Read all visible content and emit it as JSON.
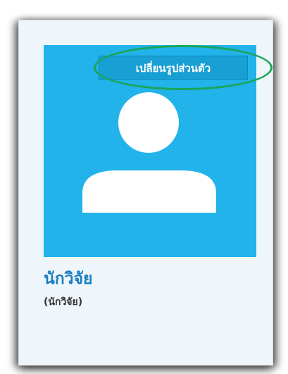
{
  "profile": {
    "change_photo_label": "เปลี่ยนรูปส่วนตัว",
    "display_name": "นักวิจัย",
    "role": "(นักวิจัย)",
    "avatar_icon": "user-silhouette-icon"
  },
  "colors": {
    "card_background": "#eef6fb",
    "photo_background": "#21b3ea",
    "button_background": "#189fd3",
    "name_text": "#1a7ec2",
    "highlight_ring": "#1aa55a"
  }
}
